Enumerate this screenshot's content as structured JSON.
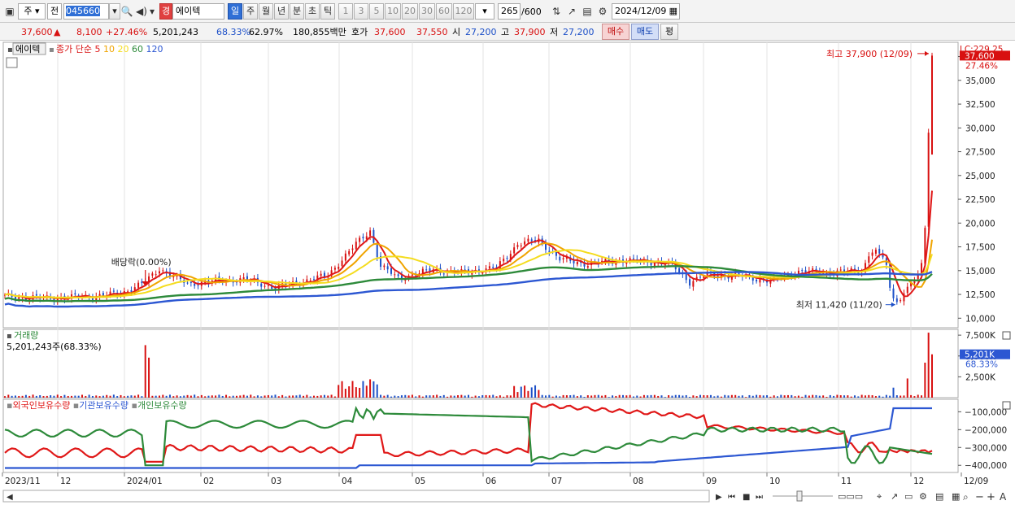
{
  "toolbar": {
    "market": "주",
    "code_prefix": "전",
    "stock_code": "045660",
    "stock_badge": "경",
    "stock_name": "에이텍",
    "periods": [
      "일",
      "주",
      "월",
      "년",
      "분",
      "초",
      "틱"
    ],
    "active_period": "일",
    "intervals": [
      "1",
      "3",
      "5",
      "10",
      "20",
      "30",
      "60",
      "120"
    ],
    "view_count": "265",
    "view_total": "/600",
    "date": "2024/12/09"
  },
  "quote": {
    "price": "37,600",
    "change": "8,100",
    "change_rate": "+27.46%",
    "volume": "5,201,243",
    "vol_ratio": "68.33%",
    "turnover": "62.97%",
    "amount": "180,855백만",
    "hoga_label": "호가",
    "ask": "37,600",
    "bid": "37,550",
    "open_label": "시",
    "open": "27,200",
    "high_label": "고",
    "high": "37,900",
    "low_label": "저",
    "low": "27,200",
    "buy_label": "매수",
    "sell_label": "매도",
    "eval_label": "평"
  },
  "price_panel": {
    "stock_label": "에이텍",
    "ma_title": "종가 단순",
    "ma_periods": [
      "5",
      "10",
      "20",
      "60",
      "120"
    ],
    "ma_colors": [
      "#e01818",
      "#f0a400",
      "#f4dc1e",
      "#2d8a3a",
      "#2c57d2"
    ],
    "lc": "LC:229.25",
    "current_price": "37,600",
    "current_rate": "27.46%",
    "high_annotation": "최고 37,900 (12/09)",
    "low_annotation": "최저 11,420 (11/20)",
    "dividend_annotation": "배당락(0.00%)"
  },
  "volume_panel": {
    "title": "거래량",
    "value": "5,201,243주(68.33%)",
    "current": "5,201K",
    "ratio": "68.33%"
  },
  "holdings_panel": {
    "series": [
      "외국인보유수량",
      "기관보유수량",
      "개인보유수량"
    ],
    "colors": [
      "#e01818",
      "#2c57d2",
      "#2d8a3a"
    ]
  },
  "x_axis": {
    "labels": [
      "2023/11",
      "12",
      "2024/01",
      "02",
      "03",
      "04",
      "05",
      "06",
      "07",
      "08",
      "09",
      "10",
      "11",
      "12",
      "12/09"
    ]
  },
  "chart_data": {
    "type": "candlestick",
    "price_axis": {
      "ticks": [
        "37,500",
        "35,000",
        "32,500",
        "30,000",
        "27,500",
        "25,000",
        "22,500",
        "20,000",
        "17,500",
        "15,000",
        "12,500",
        "10,000"
      ],
      "range": [
        9000,
        39000
      ]
    },
    "volume_axis": {
      "ticks": [
        "7,500K",
        "5,000K",
        "2,500K"
      ],
      "range": [
        0,
        8000
      ]
    },
    "holdings_axis": {
      "ticks": [
        "-100,000",
        "-200,000",
        "-300,000",
        "-400,000"
      ],
      "range": [
        -440000,
        -30000
      ]
    },
    "ohlc_approx": {
      "2023-11": [
        12200,
        12800
      ],
      "2024-01": [
        12500,
        15000
      ],
      "2024-04": [
        15800,
        19500
      ],
      "2024-06": [
        15500,
        18500
      ],
      "2024-11-20": [
        11420,
        12000
      ],
      "2024-12-09": [
        27200,
        37900,
        27200,
        37600
      ]
    }
  }
}
